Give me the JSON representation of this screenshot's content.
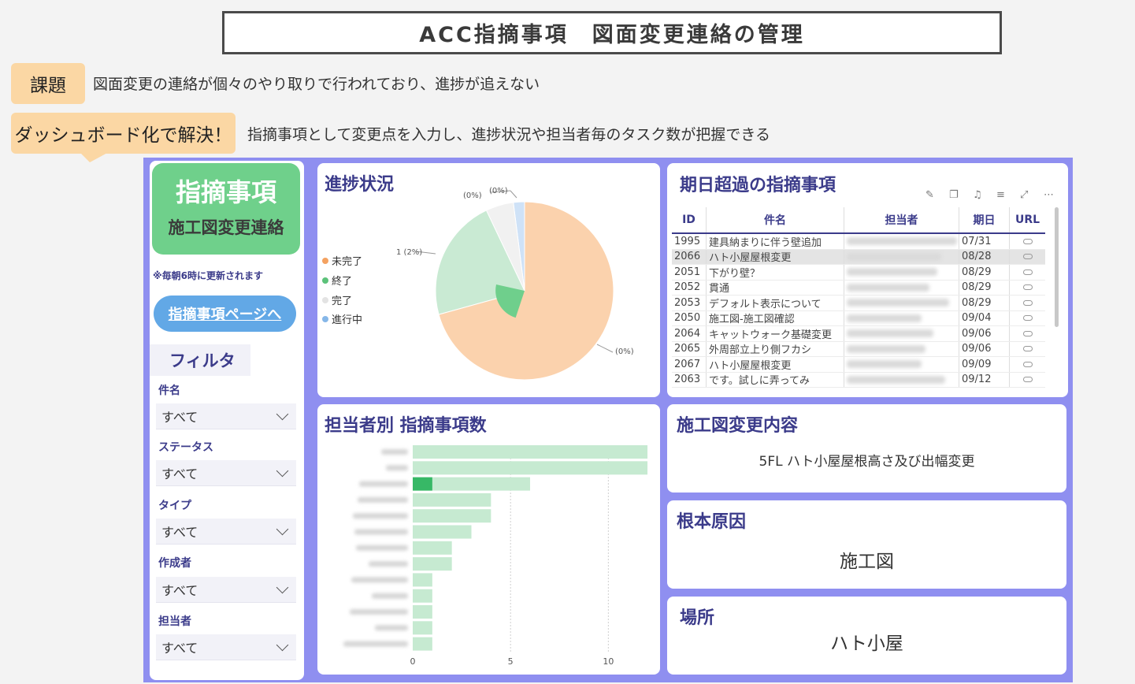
{
  "header": {
    "title": "ACC指摘事項　図面変更連絡の管理"
  },
  "issue": {
    "tag": "課題",
    "text": "図面変更の連絡が個々のやり取りで行われており、進捗が追えない"
  },
  "solution": {
    "tag": "ダッシュボード化で解決！",
    "text": "指摘事項として変更点を入力し、進捗状況や担当者毎のタスク数が把握できる"
  },
  "sidebar": {
    "logo_main": "指摘事項",
    "logo_sub": "施工図変更連絡",
    "update_note": "※毎朝6時に更新されます",
    "page_link": "指摘事項ページへ",
    "filter_title": "フィルタ",
    "filters": [
      {
        "label": "件名",
        "value": "すべて"
      },
      {
        "label": "ステータス",
        "value": "すべて"
      },
      {
        "label": "タイプ",
        "value": "すべて"
      },
      {
        "label": "作成者",
        "value": "すべて"
      },
      {
        "label": "担当者",
        "value": "すべて"
      }
    ]
  },
  "progress": {
    "title": "進捗状況",
    "legend": [
      {
        "label": "未完了",
        "color": "#f4a261"
      },
      {
        "label": "終了",
        "color": "#5cc27a"
      },
      {
        "label": "完了",
        "color": "#e3e3e3"
      },
      {
        "label": "進行中",
        "color": "#86b7e8"
      }
    ],
    "labels": {
      "top_left": "(0%)",
      "top_right": "(0%)",
      "left": "1 (2%)",
      "right": "(0%)"
    },
    "slice_colors": [
      "#fbd2ad",
      "#c9ead3",
      "#f1f1f1",
      "#cfe2f7"
    ],
    "slices": [
      {
        "value": 0.7
      },
      {
        "value": 0.22
      },
      {
        "value": 0.05
      },
      {
        "value": 0.02
      }
    ]
  },
  "overdue": {
    "title": "期日超過の指摘事項",
    "columns": [
      "ID",
      "件名",
      "担当者",
      "期日",
      "URL"
    ],
    "rows": [
      {
        "id": "1995",
        "name": "建具納まりに伴う壁追加",
        "due": "07/31"
      },
      {
        "id": "2066",
        "name": "ハト小屋屋根変更",
        "due": "08/28"
      },
      {
        "id": "2051",
        "name": "下がり壁？",
        "due": "08/29"
      },
      {
        "id": "2052",
        "name": "貫通",
        "due": "08/29"
      },
      {
        "id": "2053",
        "name": "デフォルト表示について",
        "due": "08/29"
      },
      {
        "id": "2050",
        "name": "施工図-施工図確認",
        "due": "09/04"
      },
      {
        "id": "2064",
        "name": "キャットウォーク基礎変更",
        "due": "09/06"
      },
      {
        "id": "2065",
        "name": "外周部立上り側フカシ",
        "due": "09/06"
      },
      {
        "id": "2067",
        "name": "ハト小屋屋根変更",
        "due": "09/09"
      },
      {
        "id": "2063",
        "name": "です。試しに弄ってみ",
        "due": "09/12"
      }
    ]
  },
  "assignee": {
    "title": "担当者別 指摘事項数",
    "bar_color": "#c6ead1",
    "highlight_color": "#37b866"
  },
  "chart_data": {
    "type": "bar",
    "orientation": "horizontal",
    "categories": [
      "",
      "",
      "",
      "",
      "",
      "",
      "",
      "",
      "",
      "",
      "",
      "",
      ""
    ],
    "values": [
      12,
      12,
      6,
      4,
      4,
      3,
      2,
      2,
      1,
      1,
      1,
      1,
      1
    ],
    "highlight": [
      0,
      0,
      1,
      0,
      0,
      0,
      0,
      0,
      0,
      0,
      0,
      0,
      0
    ],
    "x_ticks": [
      "0",
      "5",
      "10"
    ],
    "xlim": [
      0,
      12.2
    ],
    "grid": true
  },
  "change_detail": {
    "title": "施工図変更内容",
    "value": "5FL ハト小屋屋根高さ及び出幅変更"
  },
  "root_cause": {
    "title": "根本原因",
    "value": "施工図"
  },
  "location": {
    "title": "場所",
    "value": "ハト小屋"
  }
}
